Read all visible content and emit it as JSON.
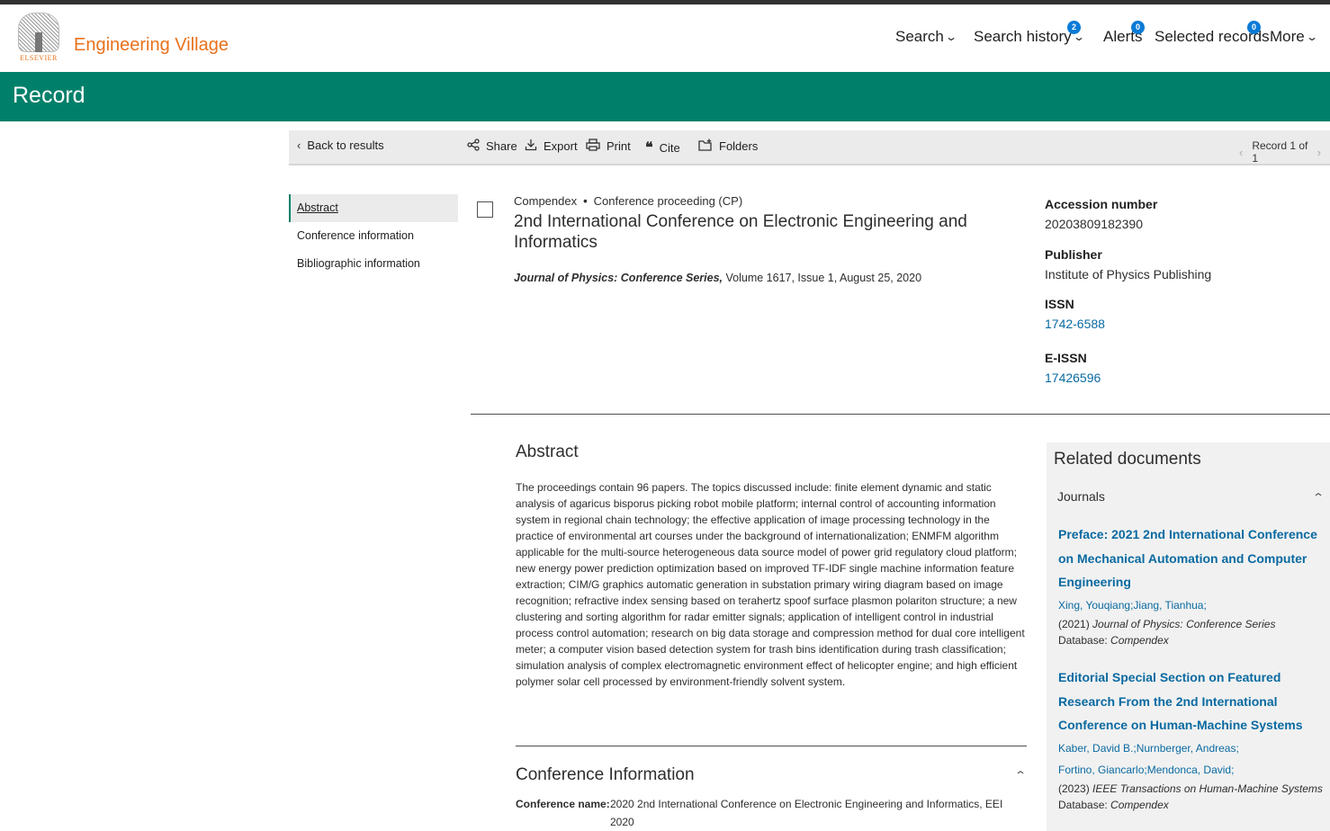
{
  "header": {
    "logo_word": "ELSEVIER",
    "brand": "Engineering Village",
    "nav": [
      {
        "label": "Search",
        "badge": null
      },
      {
        "label": "Search history",
        "badge": "2"
      },
      {
        "label": "Alerts",
        "badge": "0"
      },
      {
        "label": "Selected records",
        "badge": "0"
      },
      {
        "label": "More",
        "badge": null
      }
    ]
  },
  "page_title": "Record",
  "toolbar": {
    "back": "Back to results",
    "share": "Share",
    "export": "Export",
    "print": "Print",
    "cite": "Cite",
    "folders": "Folders",
    "record_count": "Record 1 of 1"
  },
  "side_nav": [
    "Abstract",
    "Conference information",
    "Bibliographic information"
  ],
  "record": {
    "database": "Compendex",
    "doc_type": "Conference proceeding (CP)",
    "title": "2nd International Conference on Electronic Engineering and Informatics",
    "journal": "Journal of Physics: Conference Series,",
    "journal_details": "Volume 1617, Issue 1, August 25, 2020"
  },
  "metadata": [
    {
      "label": "Accession number",
      "value": "20203809182390",
      "link": false
    },
    {
      "label": "Publisher",
      "value": "Institute of Physics Publishing",
      "link": false
    },
    {
      "label": "ISSN",
      "value": "1742-6588",
      "link": true
    },
    {
      "label": "E-ISSN",
      "value": "17426596",
      "link": true
    }
  ],
  "abstract": {
    "heading": "Abstract",
    "text": "The proceedings contain 96 papers. The topics discussed include: finite element dynamic and static analysis of agaricus bisporus picking robot mobile platform; internal control of accounting information system in regional chain technology; the effective application of image processing technology in the practice of environmental art courses under the background of internationalization; ENMFM algorithm applicable for the multi-source heterogeneous data source model of power grid regulatory cloud platform; new energy power prediction optimization based on improved TF-IDF single machine information feature extraction; CIM/G graphics automatic generation in substation primary wiring diagram based on image recognition; refractive index sensing based on terahertz spoof surface plasmon polariton structure; a new clustering and sorting algorithm for radar emitter signals; application of intelligent control in industrial process control automation; research on big data storage and compression method for dual core intelligent meter; a computer vision based detection system for trash bins identification during trash classification; simulation analysis of complex electromagnetic environment effect of helicopter engine; and high efficient polymer solar cell processed by environment-friendly solvent system."
  },
  "conference": {
    "heading": "Conference Information",
    "name_label": "Conference name:",
    "name_value": "2020 2nd International Conference on Electronic Engineering and Informatics, EEI 2020"
  },
  "related": {
    "heading": "Related documents",
    "subheading": "Journals",
    "docs": [
      {
        "title": "Preface: 2021 2nd International Conference on Mechanical Automation and Computer Engineering",
        "authors": [
          "Xing, Youqiang;",
          "Jiang, Tianhua;"
        ],
        "year": "(2021)",
        "journal": "Journal of Physics: Conference Series",
        "db_label": "Database:",
        "db": "Compendex"
      },
      {
        "title": "Editorial Special Section on Featured Research From the 2nd International Conference on Human-Machine Systems",
        "authors": [
          "Kaber, David B.;",
          "Nurnberger, Andreas;",
          "Fortino, Giancarlo;",
          "Mendonca, David;"
        ],
        "year": "(2023)",
        "journal": "IEEE Transactions on Human-Machine Systems",
        "db_label": "Database:",
        "db": "Compendex"
      }
    ]
  },
  "colors": {
    "brand_orange": "#e9711c",
    "header_green": "#00806a",
    "link_blue": "#0a6aa1",
    "badge_blue": "#0a7bd6"
  }
}
